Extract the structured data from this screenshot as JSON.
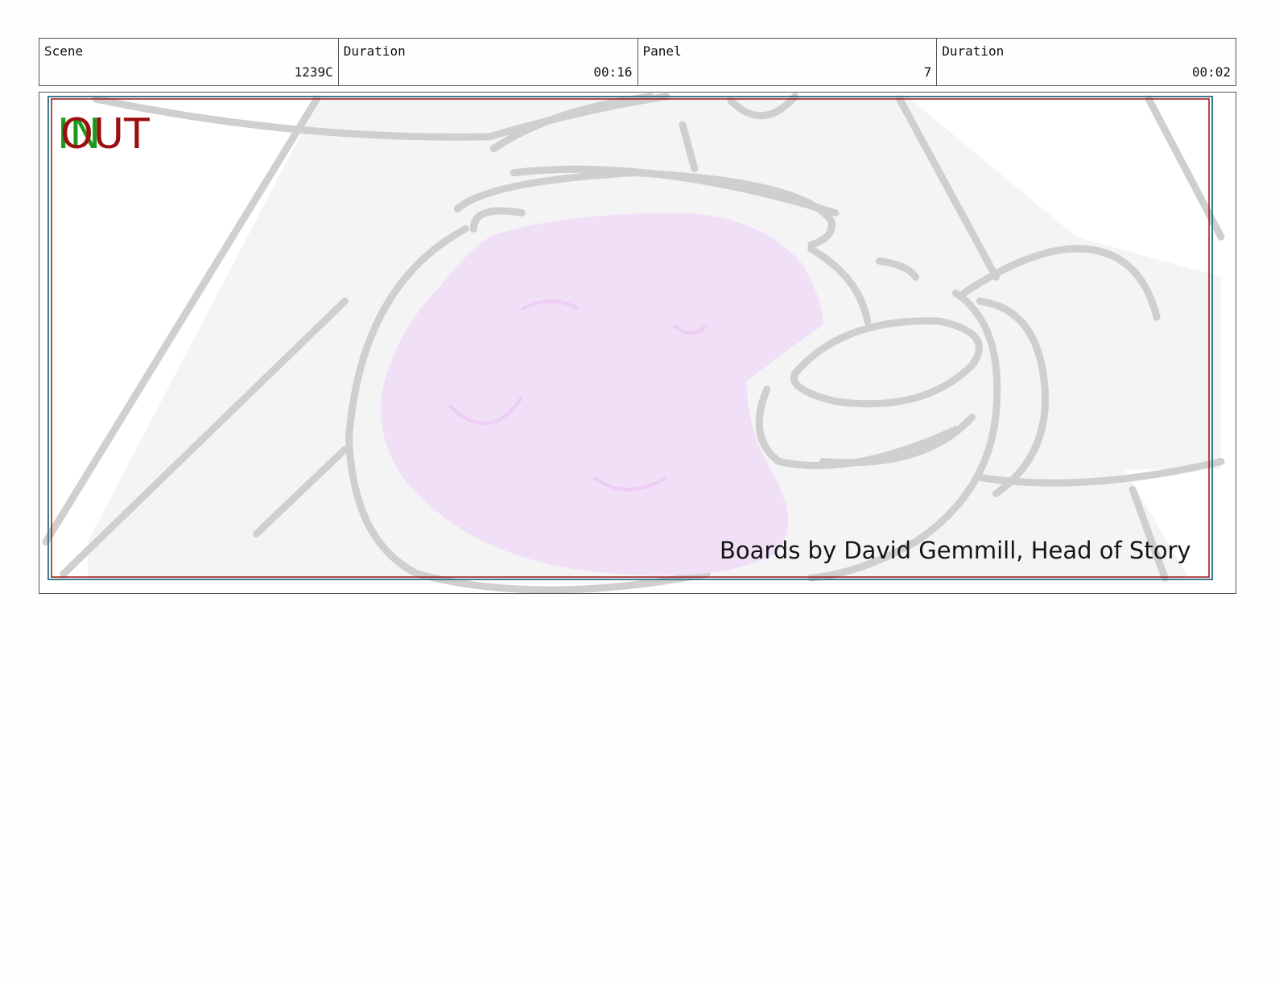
{
  "header": {
    "scene_label": "Scene",
    "scene_value": "1239C",
    "scene_duration_label": "Duration",
    "scene_duration_value": "00:16",
    "panel_label": "Panel",
    "panel_value": "7",
    "panel_duration_label": "Duration",
    "panel_duration_value": "00:02"
  },
  "panel": {
    "in_marker": "IN",
    "out_marker": "OUT",
    "caption": "Boards by David Gemmill, Head of Story"
  },
  "colors": {
    "in_marker": "#1a9a1a",
    "out_marker": "#9a0f0f",
    "sketch_stroke": "#cfcfcf",
    "sketch_fill": "#f4f4f4",
    "pink_fill": "#f1def7"
  }
}
